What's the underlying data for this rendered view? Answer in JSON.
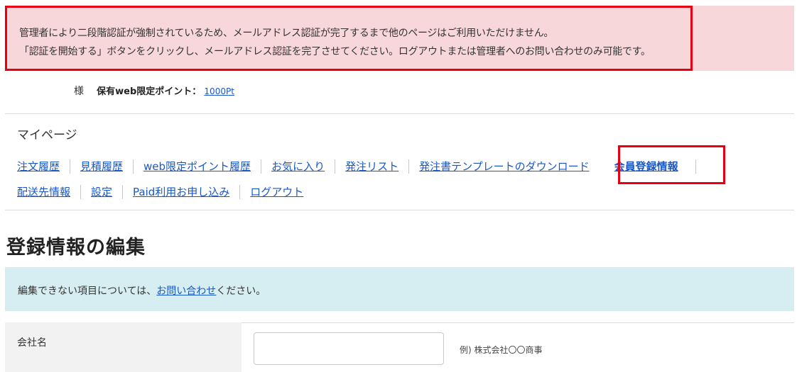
{
  "alert": {
    "line1": "管理者により二段階認証が強制されているため、メールアドレス認証が完了するまで他のページはご利用いただけません。",
    "line2": "「認証を開始する」ボタンをクリックし、メールアドレス認証を完了させてください。ログアウトまたは管理者へのお問い合わせのみ可能です。"
  },
  "user": {
    "honorific": "様",
    "points_label": "保有web限定ポイント：",
    "points_value": "1000Pt"
  },
  "mypage": {
    "title": "マイページ",
    "nav_row1": [
      {
        "label": "注文履歴"
      },
      {
        "label": "見積履歴"
      },
      {
        "label": "web限定ポイント履歴"
      },
      {
        "label": "お気に入り"
      },
      {
        "label": "発注リスト"
      },
      {
        "label": "発注書テンプレートのダウンロード"
      },
      {
        "label": "会員登録情報",
        "active": true
      }
    ],
    "nav_row2": [
      {
        "label": "配送先情報"
      },
      {
        "label": "設定"
      },
      {
        "label": "Paid利用お申し込み"
      },
      {
        "label": "ログアウト"
      }
    ]
  },
  "page": {
    "title": "登録情報の編集",
    "info_prefix": "編集できない項目については、",
    "info_link": "お問い合わせ",
    "info_suffix": "ください。"
  },
  "form": {
    "company_label": "会社名",
    "company_value": "",
    "company_example": "例) 株式会社〇〇商事"
  },
  "colors": {
    "alert_bg": "#f8d7da",
    "highlight": "#e60012",
    "link": "#1a57c7",
    "info_bg": "#d6eef2"
  }
}
